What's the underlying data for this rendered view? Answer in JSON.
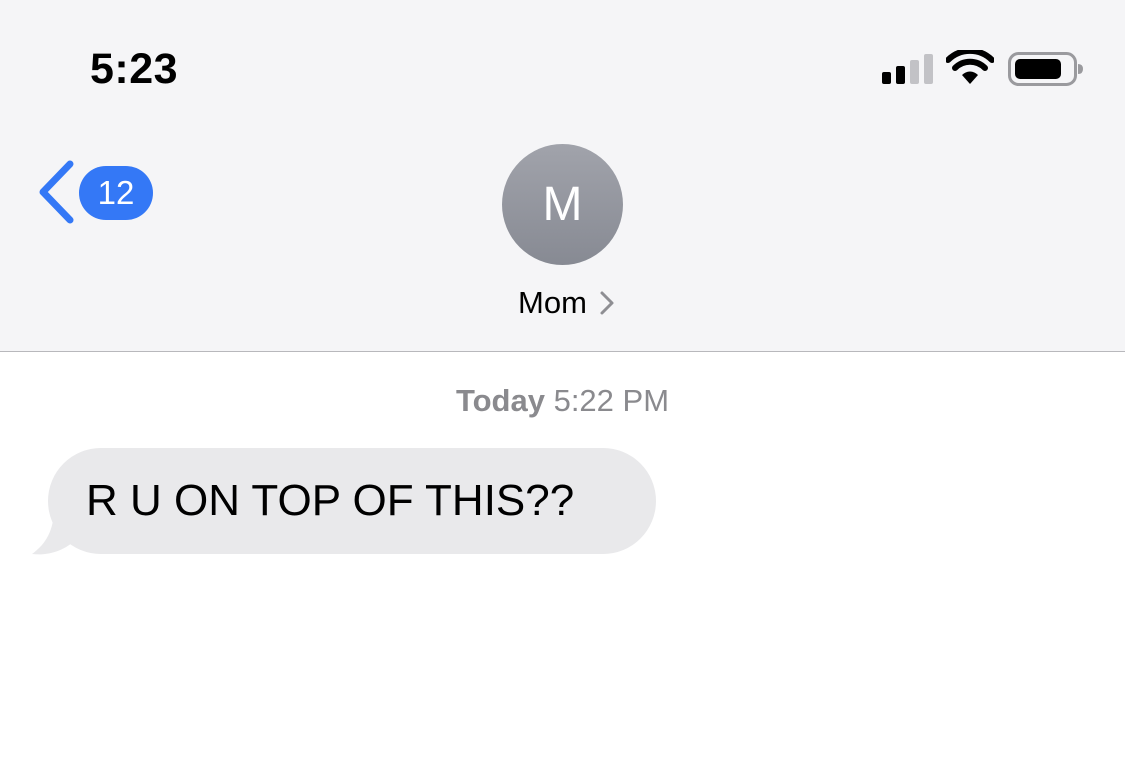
{
  "status_bar": {
    "time": "5:23",
    "signal_icon": "cellular-signal-icon",
    "wifi_icon": "wifi-icon",
    "battery_icon": "battery-icon"
  },
  "nav": {
    "back_icon": "chevron-left-icon",
    "unread_count": "12",
    "accent_color": "#3478f6"
  },
  "contact": {
    "initial": "M",
    "name": "Mom",
    "chevron_icon": "chevron-right-icon"
  },
  "conversation": {
    "timestamp_day": "Today",
    "timestamp_time": "5:22 PM",
    "messages": [
      {
        "direction": "incoming",
        "text": "R U ON TOP OF THIS??",
        "bubble_color": "#e9e9eb"
      }
    ]
  }
}
